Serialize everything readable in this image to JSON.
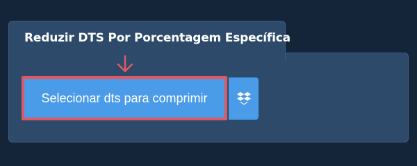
{
  "tab": {
    "title": "Reduzir DTS Por Porcentagem Específica"
  },
  "upload": {
    "select_label": "Selecionar dts para comprimir",
    "dropbox_icon": "dropbox-icon",
    "arrow_icon": "arrow-down-icon"
  },
  "colors": {
    "background": "#14253a",
    "panel": "#2e4a6b",
    "button": "#4a9be8",
    "highlight": "#e05864"
  }
}
